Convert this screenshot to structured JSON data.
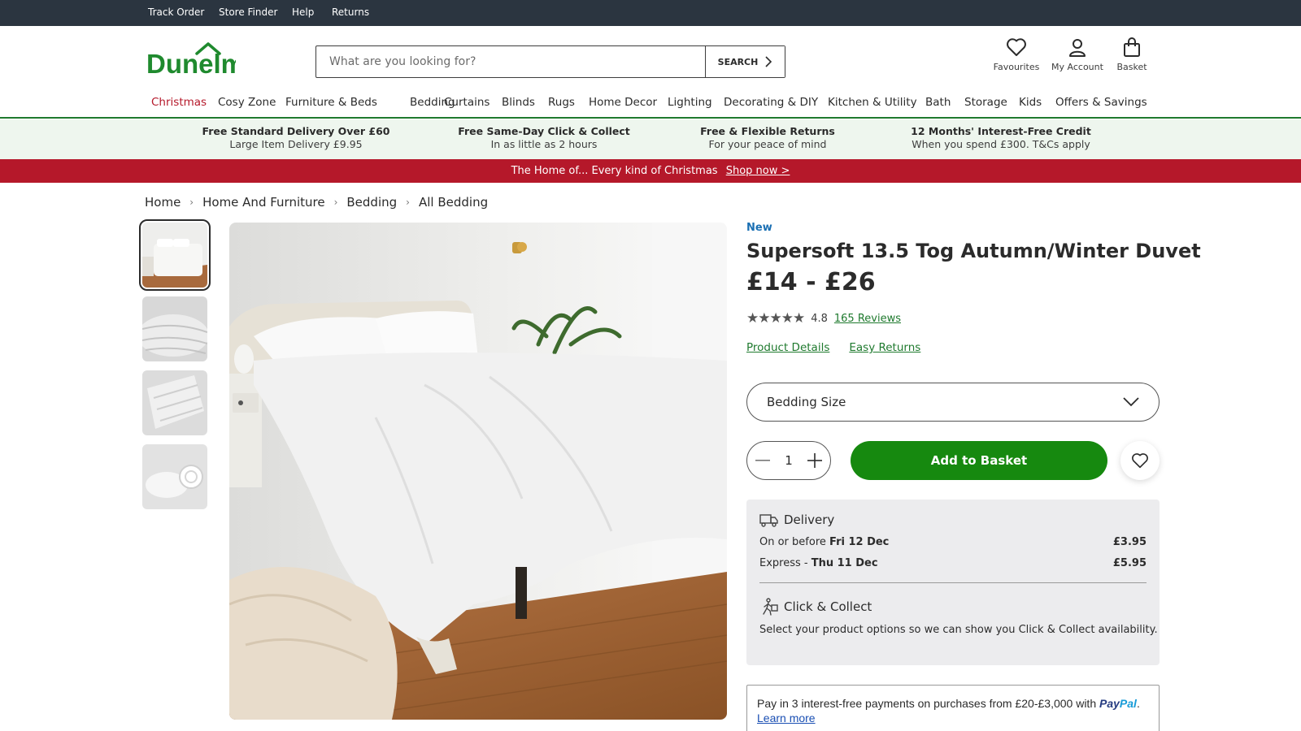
{
  "utility_nav": [
    "Track Order",
    "Store Finder",
    "Help",
    "Returns"
  ],
  "brand": {
    "logo_text": "Dunelm",
    "color": "#1f8a2e"
  },
  "search": {
    "placeholder": "What are you looking for?",
    "button_label": "SEARCH"
  },
  "header_actions": {
    "favourites": "Favourites",
    "account": "My Account",
    "basket": "Basket"
  },
  "main_nav": [
    "Christmas",
    "Cosy Zone",
    "Furniture & Beds",
    "Bedding",
    "Curtains",
    "Blinds",
    "Rugs",
    "Home Decor",
    "Lighting",
    "Decorating & DIY",
    "Kitchen & Utility",
    "Bath",
    "Storage",
    "Kids",
    "Offers & Savings"
  ],
  "usps": [
    {
      "title": "Free Standard Delivery Over £60",
      "sub": "Large Item Delivery £9.95"
    },
    {
      "title": "Free Same-Day Click & Collect",
      "sub": "In as little as 2 hours"
    },
    {
      "title": "Free & Flexible Returns",
      "sub": "For your peace of mind"
    },
    {
      "title": "12 Months' Interest-Free Credit",
      "sub": "When you spend £300. T&Cs apply"
    }
  ],
  "promo": {
    "text": "The Home of... Every kind of Christmas",
    "link": "Shop now >"
  },
  "breadcrumb": [
    "Home",
    "Home And Furniture",
    "Bedding",
    "All Bedding"
  ],
  "product": {
    "tag": "New",
    "title": "Supersoft 13.5 Tog Autumn/Winter Duvet",
    "price": "£14 - £26",
    "stars": "★★★★★",
    "rating": "4.8",
    "reviews": "165 Reviews",
    "links": [
      "Product Details",
      "Easy Returns"
    ],
    "size_label": "Bedding Size",
    "quantity": "1",
    "add_label": "Add to Basket"
  },
  "delivery": {
    "title": "Delivery",
    "standard": {
      "prefix": "On or before ",
      "date": "Fri 12 Dec",
      "price": "£3.95"
    },
    "express": {
      "prefix": "Express - ",
      "date": "Thu 11 Dec",
      "price": "£5.95"
    },
    "collect_title": "Click & Collect",
    "collect_note": "Select your product options so we can show you Click & Collect availability."
  },
  "paypal": {
    "text": "Pay in 3 interest-free payments on purchases from £20-£3,000 with ",
    "logo_a": "Pay",
    "logo_b": "Pal",
    "suffix": ".",
    "link": "Learn more"
  },
  "colors": {
    "accent_green": "#16890f",
    "promo_red": "#b5182a",
    "link_green": "#1f7a2e",
    "new_blue": "#1a6fb3"
  }
}
